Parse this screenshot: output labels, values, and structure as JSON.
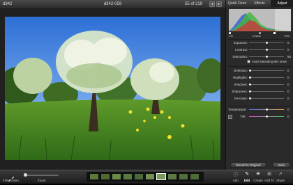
{
  "titlebar": {
    "left": "d342",
    "center": "d342-059",
    "right": "55 of 219"
  },
  "tabs": [
    {
      "label": "Quick Fixes",
      "active": false
    },
    {
      "label": "Effects",
      "active": false
    },
    {
      "label": "Adjust",
      "active": true
    }
  ],
  "levels": {
    "min_label": "1%",
    "center_label": "Levels",
    "max_label": "79%"
  },
  "sliders1": [
    {
      "label": "Exposure:",
      "value": "0",
      "level": 0.5
    },
    {
      "label": "Contrast:",
      "value": "0",
      "level": 0.5
    },
    {
      "label": "Saturation:",
      "value": "50",
      "level": 0.5
    }
  ],
  "checkbox_label": "Avoid saturating skin tones",
  "sliders2": [
    {
      "label": "Definition:",
      "value": "0",
      "level": 0.0
    },
    {
      "label": "Highlights:",
      "value": "0",
      "level": 0.0
    },
    {
      "label": "Shadows:",
      "value": "0",
      "level": 0.0
    },
    {
      "label": "Sharpness:",
      "value": "0",
      "level": 0.0
    },
    {
      "label": "De-noise:",
      "value": "0",
      "level": 0.0
    }
  ],
  "temperature": {
    "label": "Temperature:",
    "value": "0",
    "level": 0.5
  },
  "tint": {
    "label": "Tint:",
    "value": "0",
    "level": 0.5
  },
  "buttons": {
    "revert": "Revert to Original",
    "undo": "Undo"
  },
  "toolbar": {
    "fullscreen": "Full Screen",
    "zoom": "Zoom",
    "zoom_level": 0.0,
    "actions": [
      "Info",
      "Edit",
      "Create",
      "Add To",
      "Share"
    ],
    "active_action": "Edit"
  },
  "colors": {
    "accent": "#6b8fe0",
    "panel": "#2a2a2a",
    "toolbar": "#2a2a2a"
  },
  "thumbnails": [
    {
      "color": "#5b7a3a"
    },
    {
      "color": "#4e6a32"
    },
    {
      "color": "#6a8a4a"
    },
    {
      "color": "#587a40"
    },
    {
      "color": "#4a6a38"
    },
    {
      "color": "#6f8f55"
    },
    {
      "color": "#7a9a60"
    },
    {
      "color": "#5a7a42"
    },
    {
      "color": "#50703a"
    },
    {
      "color": "#4c6b35"
    }
  ]
}
